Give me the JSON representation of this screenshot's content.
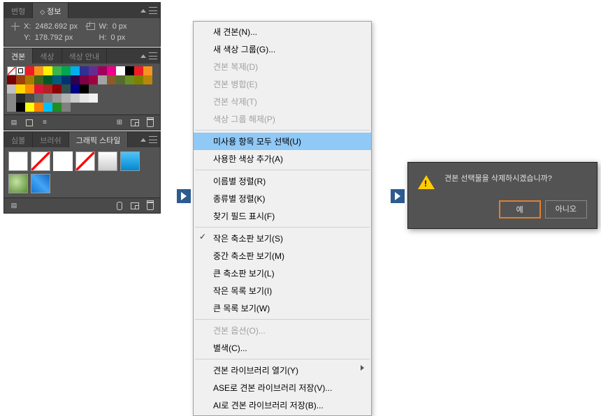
{
  "info_panel": {
    "tabs": [
      "변형",
      "정보"
    ],
    "active_tab": 1,
    "x_label": "X:",
    "x_value": "2482.692 px",
    "y_label": "Y:",
    "y_value": "178.792 px",
    "w_label": "W:",
    "w_value": "0 px",
    "h_label": "H:",
    "h_value": "0 px"
  },
  "swatches_panel": {
    "tabs": [
      "견본",
      "색상",
      "색상 안내"
    ],
    "active_tab": 0,
    "colors_row1": [
      "#ffffff",
      "#000000",
      "#ed1c24",
      "#f7941e",
      "#fff200",
      "#39b54a",
      "#00a651",
      "#00aeef",
      "#2e3192",
      "#662d91",
      "#9e005d",
      "#ec008c",
      "#ffffff",
      "#000000",
      "#ed1c24",
      "#f7941e"
    ],
    "colors_row2": [
      "#790000",
      "#a0410d",
      "#a67c00",
      "#406618",
      "#005826",
      "#005b7f",
      "#003471",
      "#32004b",
      "#7b0046",
      "#a10040",
      "#a3a3a3",
      "#8b5a2b",
      "#556b2f",
      "#6b8e23",
      "#808000",
      "#b8860b"
    ],
    "colors_row3": [
      "#c0c0c0",
      "#ffd700",
      "#ff8c00",
      "#dc143c",
      "#b22222",
      "#8b0000",
      "#2f4f4f",
      "#000080",
      "#000000"
    ],
    "colors_row4": [
      "#2b2b2b",
      "#4a4a4a",
      "#666666",
      "#808080",
      "#999999",
      "#b3b3b3",
      "#cccccc",
      "#e6e6e6",
      "#f2f2f2"
    ],
    "colors_row5": [
      "#000000",
      "#ffff00",
      "#ff7f00",
      "#00bfff",
      "#228b22",
      "#808080"
    ],
    "footer_select": "▮"
  },
  "styles_panel": {
    "tabs": [
      "심볼",
      "브러쉬",
      "그래픽 스타일"
    ],
    "active_tab": 2
  },
  "menu": {
    "items": [
      {
        "label": "새 견본(N)...",
        "enabled": true
      },
      {
        "label": "새 색상 그룹(G)...",
        "enabled": true
      },
      {
        "label": "견본 복제(D)",
        "enabled": false
      },
      {
        "label": "견본 병합(E)",
        "enabled": false
      },
      {
        "label": "견본 삭제(T)",
        "enabled": false
      },
      {
        "label": "색상 그룹 해제(P)",
        "enabled": false
      },
      {
        "sep": true
      },
      {
        "label": "미사용 항목 모두 선택(U)",
        "enabled": true,
        "highlighted": true
      },
      {
        "label": "사용한 색상 추가(A)",
        "enabled": true
      },
      {
        "sep": true
      },
      {
        "label": "이름별 정렬(R)",
        "enabled": true
      },
      {
        "label": "종류별 정렬(K)",
        "enabled": true
      },
      {
        "label": "찾기 필드 표시(F)",
        "enabled": true
      },
      {
        "sep": true
      },
      {
        "label": "작은 축소판 보기(S)",
        "enabled": true,
        "checked": true
      },
      {
        "label": "중간 축소판 보기(M)",
        "enabled": true
      },
      {
        "label": "큰 축소판 보기(L)",
        "enabled": true
      },
      {
        "label": "작은 목록 보기(I)",
        "enabled": true
      },
      {
        "label": "큰 목록 보기(W)",
        "enabled": true
      },
      {
        "sep": true
      },
      {
        "label": "견본 옵션(O)...",
        "enabled": false
      },
      {
        "label": "별색(C)...",
        "enabled": true
      },
      {
        "sep": true
      },
      {
        "label": "견본 라이브러리 열기(Y)",
        "enabled": true,
        "submenu": true
      },
      {
        "label": "ASE로 견본 라이브러리 저장(V)...",
        "enabled": true
      },
      {
        "label": "AI로 견본 라이브러리 저장(B)...",
        "enabled": true
      }
    ]
  },
  "dialog": {
    "message": "견본 선택물을 삭제하시겠습니까?",
    "yes": "예",
    "no": "아니오"
  }
}
